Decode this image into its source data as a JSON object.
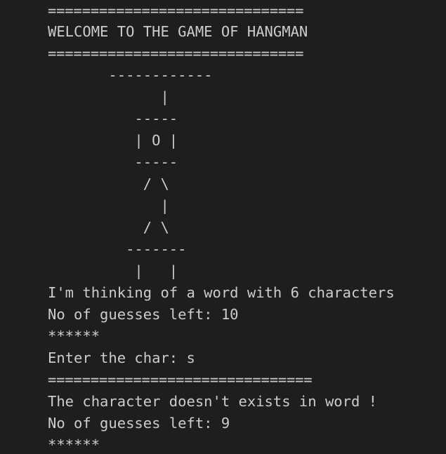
{
  "terminal": {
    "lines": [
      "==============================",
      "WELCOME TO THE GAME OF HANGMAN",
      "==============================",
      "       ------------",
      "             |",
      "          -----",
      "          | O |",
      "          -----",
      "           / \\",
      "             |",
      "           / \\",
      "         -------",
      "          |   |",
      "I'm thinking of a word with 6 characters",
      "No of guesses left: 10",
      "******",
      "Enter the char: s",
      "===============================",
      "The character doesn't exists in word !",
      "No of guesses left: 9",
      "******"
    ]
  }
}
